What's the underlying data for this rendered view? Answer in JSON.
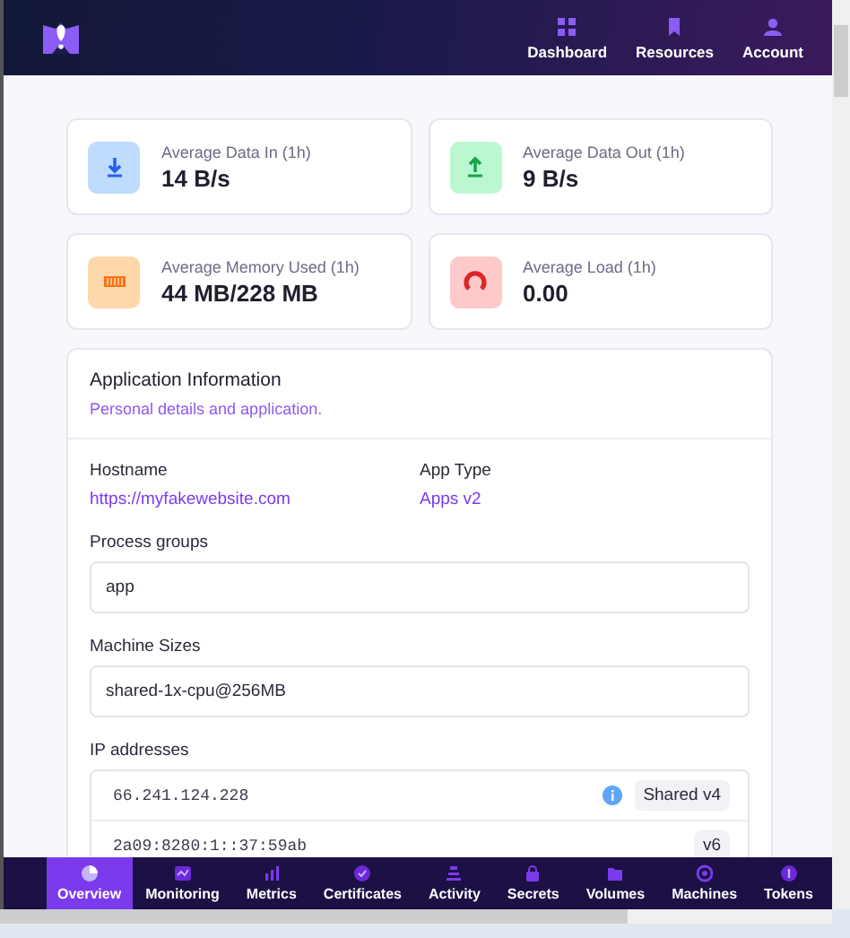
{
  "header": {
    "nav": [
      {
        "label": "Dashboard"
      },
      {
        "label": "Resources"
      },
      {
        "label": "Account"
      }
    ]
  },
  "stats": [
    {
      "kind": "download",
      "label": "Average Data In (1h)",
      "value": "14 B/s"
    },
    {
      "kind": "upload",
      "label": "Average Data Out (1h)",
      "value": "9 B/s"
    },
    {
      "kind": "memory",
      "label": "Average Memory Used (1h)",
      "value": "44 MB/228 MB"
    },
    {
      "kind": "load",
      "label": "Average Load (1h)",
      "value": "0.00"
    }
  ],
  "info": {
    "title": "Application Information",
    "subtitle": "Personal details and application.",
    "pairs": [
      {
        "label": "Hostname",
        "value": "https://myfakewebsite.com"
      },
      {
        "label": "App Type",
        "value": "Apps v2"
      }
    ],
    "fields": [
      {
        "label": "Process groups",
        "value": "app"
      },
      {
        "label": "Machine Sizes",
        "value": "shared-1x-cpu@256MB"
      }
    ],
    "ip_addresses": {
      "label": "IP addresses",
      "rows": [
        {
          "address": "66.241.124.228",
          "badge": "Shared v4",
          "info": true
        },
        {
          "address": "2a09:8280:1::37:59ab",
          "badge": "v6",
          "info": false
        }
      ]
    }
  },
  "bottom_nav": [
    {
      "label": "Overview",
      "selected": true
    },
    {
      "label": "Monitoring",
      "selected": false
    },
    {
      "label": "Metrics",
      "selected": false
    },
    {
      "label": "Certificates",
      "selected": false
    },
    {
      "label": "Activity",
      "selected": false
    },
    {
      "label": "Secrets",
      "selected": false
    },
    {
      "label": "Volumes",
      "selected": false
    },
    {
      "label": "Machines",
      "selected": false
    },
    {
      "label": "Tokens",
      "selected": false
    }
  ]
}
